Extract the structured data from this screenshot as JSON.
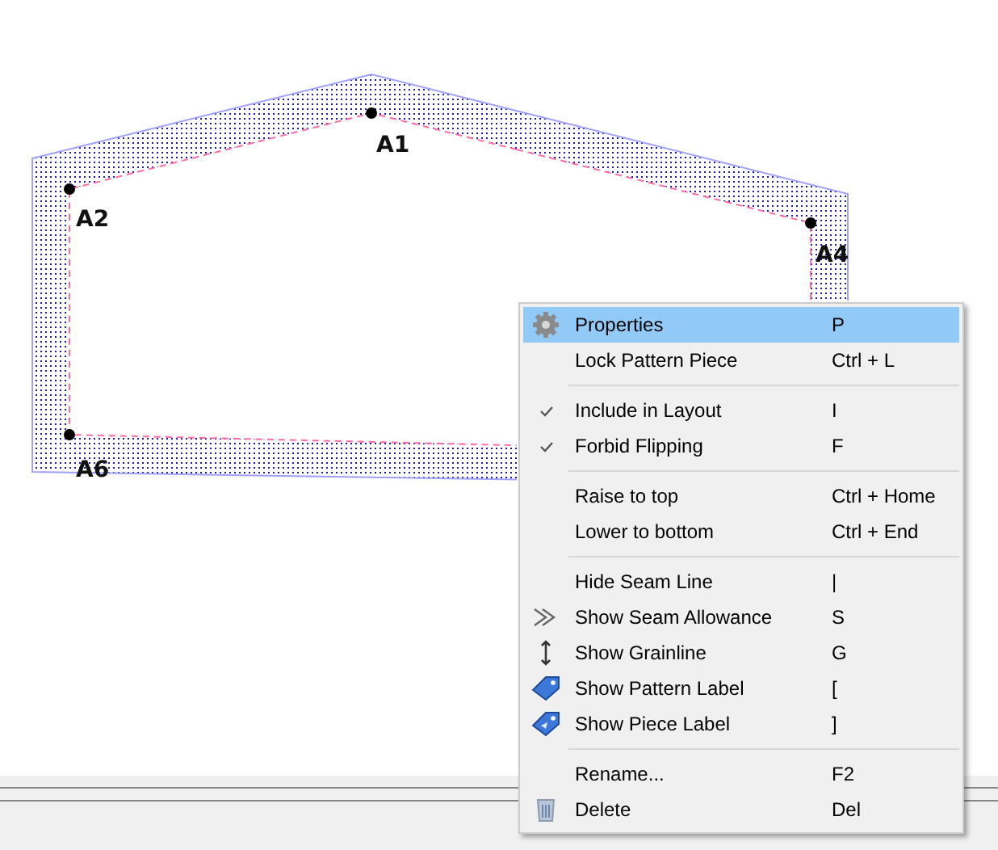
{
  "canvas": {
    "points": [
      {
        "label": "A1"
      },
      {
        "label": "A2"
      },
      {
        "label": "A4"
      },
      {
        "label": "A6"
      }
    ]
  },
  "context_menu": {
    "items": [
      {
        "kind": "item",
        "label": "Properties",
        "shortcut": "P",
        "checked": false,
        "selected": true
      },
      {
        "kind": "item",
        "label": "Lock Pattern Piece",
        "shortcut": "Ctrl + L",
        "checked": false,
        "selected": false
      },
      {
        "kind": "separator"
      },
      {
        "kind": "item",
        "label": "Include in Layout",
        "shortcut": "I",
        "checked": true,
        "selected": false
      },
      {
        "kind": "item",
        "label": "Forbid Flipping",
        "shortcut": "F",
        "checked": true,
        "selected": false
      },
      {
        "kind": "separator"
      },
      {
        "kind": "item",
        "label": "Raise to top",
        "shortcut": "Ctrl + Home",
        "checked": false,
        "selected": false
      },
      {
        "kind": "item",
        "label": "Lower to bottom",
        "shortcut": "Ctrl + End",
        "checked": false,
        "selected": false
      },
      {
        "kind": "separator"
      },
      {
        "kind": "item",
        "label": "Hide Seam Line",
        "shortcut": "|",
        "checked": false,
        "selected": false
      },
      {
        "kind": "item",
        "label": "Show Seam Allowance",
        "shortcut": "S",
        "checked": false,
        "selected": false
      },
      {
        "kind": "item",
        "label": "Show Grainline",
        "shortcut": "G",
        "checked": false,
        "selected": false
      },
      {
        "kind": "item",
        "label": "Show Pattern Label",
        "shortcut": "[",
        "checked": false,
        "selected": false
      },
      {
        "kind": "item",
        "label": "Show Piece Label",
        "shortcut": "]",
        "checked": false,
        "selected": false
      },
      {
        "kind": "separator"
      },
      {
        "kind": "item",
        "label": "Rename...",
        "shortcut": "F2",
        "checked": false,
        "selected": false
      },
      {
        "kind": "item",
        "label": "Delete",
        "shortcut": "Del",
        "checked": false,
        "selected": false
      }
    ]
  }
}
